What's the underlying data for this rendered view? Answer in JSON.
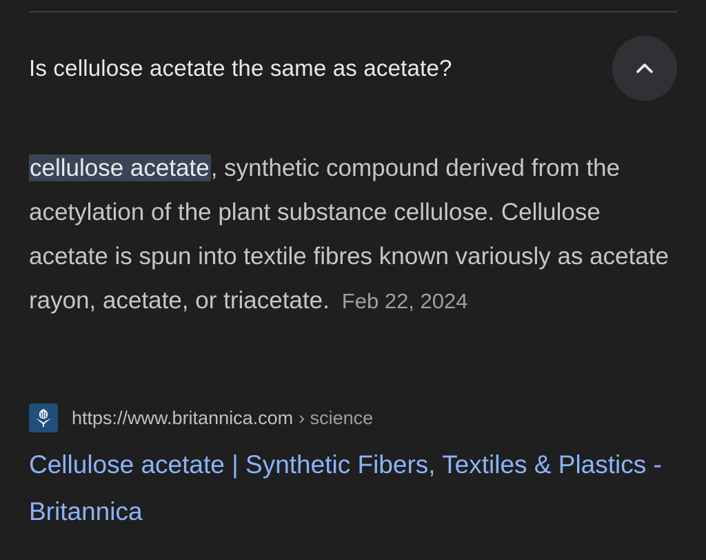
{
  "question": {
    "text": "Is cellulose acetate the same as acetate?",
    "toggle_icon": "chevron-up-icon"
  },
  "answer": {
    "highlighted_term": "cellulose acetate",
    "body": ", synthetic compound derived from the acetylation of the plant substance cellulose. Cellulose acetate is spun into textile fibres known variously as acetate rayon, acetate, or triacetate.",
    "date": "Feb 22, 2024"
  },
  "source": {
    "favicon": "britannica-logo-icon",
    "url": "https://www.britannica.com",
    "separator": "›",
    "path": "science"
  },
  "result": {
    "title": "Cellulose acetate | Synthetic Fibers, Textiles & Plastics - Britannica"
  },
  "colors": {
    "background": "#1f1f1f",
    "link": "#8ab4f8",
    "highlight": "#394457"
  }
}
